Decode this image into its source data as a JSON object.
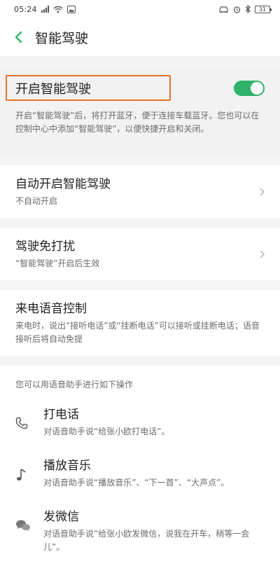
{
  "status_bar": {
    "time": "05:24",
    "battery": "31"
  },
  "header": {
    "title": "智能驾驶"
  },
  "master_toggle": {
    "label": "开启智能驾驶",
    "on": true,
    "description": "开启“智能驾驶”后，将打开蓝牙，便于连接车载蓝牙。您也可以在控制中心中添加“智能驾驶”，以便快捷开启和关闭。"
  },
  "settings": [
    {
      "title": "自动开启智能驾驶",
      "subtitle": "不自动开启",
      "has_arrow": true
    },
    {
      "title": "驾驶免打扰",
      "subtitle": "“智能驾驶”开启后生效",
      "has_arrow": true
    },
    {
      "title": "来电语音控制",
      "subtitle": "来电时，说出“接听电话”或“挂断电话”可以接听或挂断电话；语音接听后将自动免提",
      "has_arrow": false
    }
  ],
  "voice_tips": {
    "heading": "您可以用语音助手进行如下操作",
    "items": [
      {
        "icon": "phone-icon",
        "title": "打电话",
        "subtitle": "对语音助手说“给张小欧打电话”。"
      },
      {
        "icon": "music-note-icon",
        "title": "播放音乐",
        "subtitle": "对语音助手说“播放音乐”、“下一首”、“大声点”。"
      },
      {
        "icon": "chat-bubbles-icon",
        "title": "发微信",
        "subtitle": "对语音助手说“给张小欧发微信，说我在开车，稍等一会儿”。"
      }
    ]
  },
  "colors": {
    "accent": "#2fb36a",
    "highlight": "#e5732d",
    "back_arrow": "#2fb36a"
  }
}
